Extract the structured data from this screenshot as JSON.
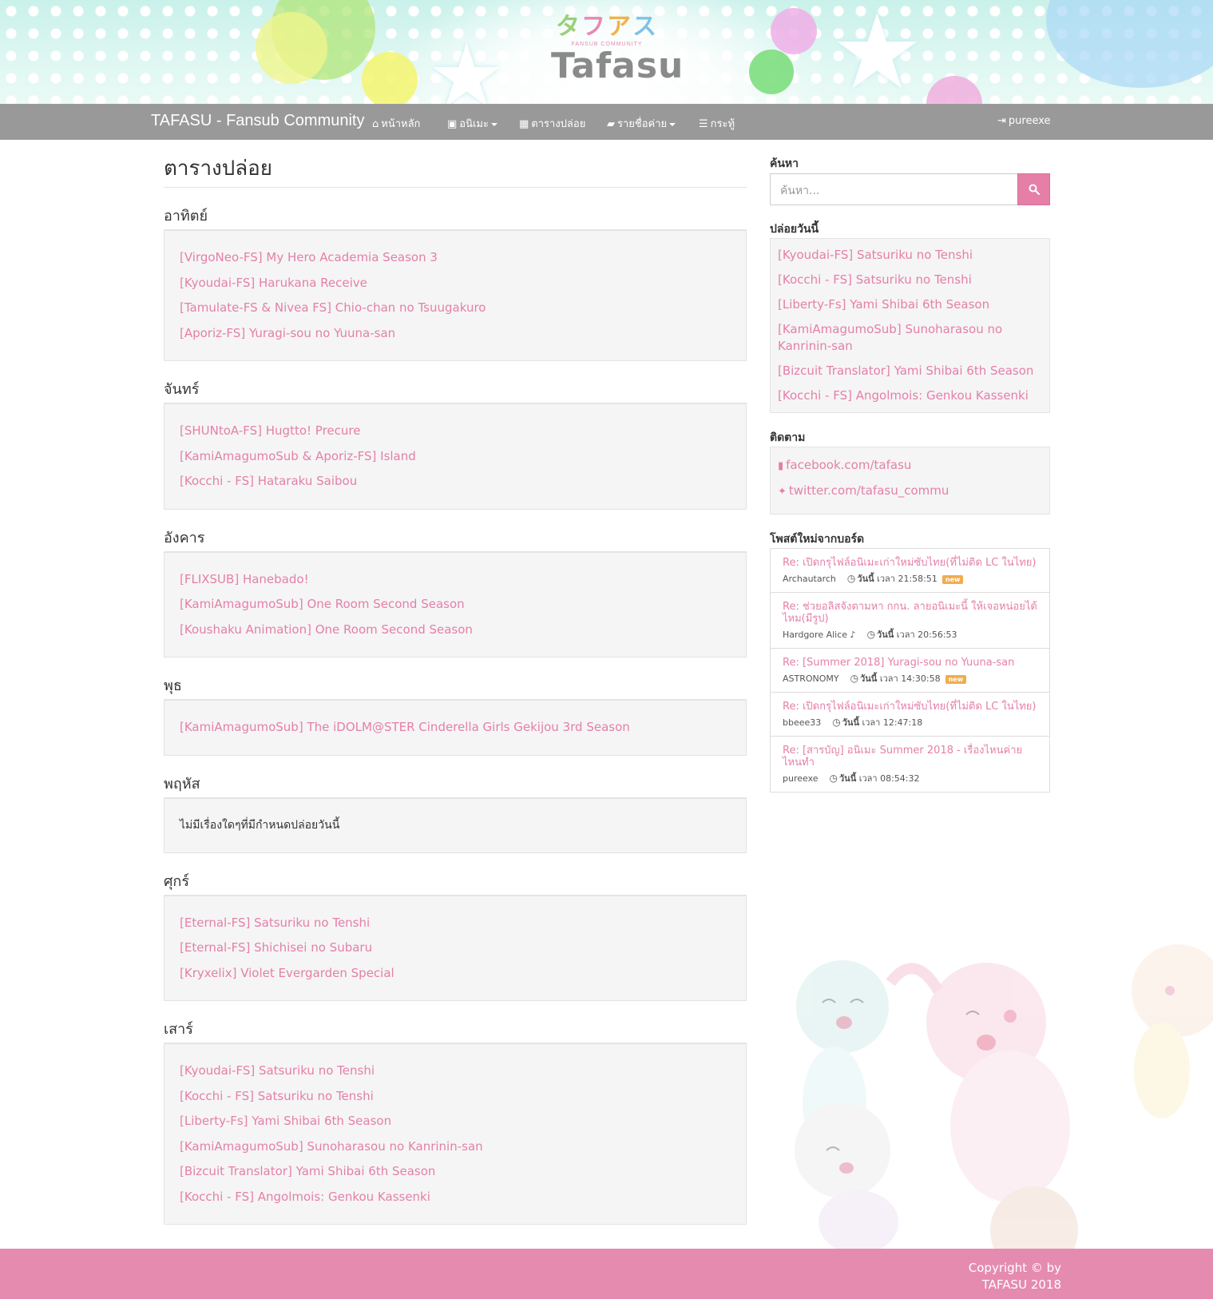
{
  "banner": {
    "logo_jp": [
      "タ",
      "フ",
      "ア",
      "ス"
    ],
    "logo_sub": "FANSUB COMMUNITY",
    "logo_en": "Tafasu"
  },
  "navbar": {
    "brand": "TAFASU - Fansub Community",
    "items": [
      {
        "label": "หน้าหลัก",
        "icon": "home-icon"
      },
      {
        "label": "อนิเมะ",
        "icon": "film-icon"
      },
      {
        "label": "ตารางปล่อย",
        "icon": "calendar-icon"
      },
      {
        "label": "รายชื่อค่าย",
        "icon": "folder-open-icon"
      },
      {
        "label": "กระทู้",
        "icon": "list-icon"
      }
    ],
    "user": "pureexe",
    "user_icon": "login-icon"
  },
  "main": {
    "title": "ตารางปล่อย",
    "days": [
      {
        "name": "อาทิตย์",
        "items": [
          "[VirgoNeo-FS] My Hero Academia Season 3",
          "[Kyoudai-FS] Harukana Receive",
          "[Tamulate-FS & Nivea FS] Chio-chan no Tsuugakuro",
          "[Aporiz-FS] Yuragi-sou no Yuuna-san"
        ]
      },
      {
        "name": "จันทร์",
        "items": [
          "[SHUNtoA-FS] Hugtto! Precure",
          "[KamiAmagumoSub & Aporiz-FS] Island",
          "[Kocchi - FS] Hataraku Saibou"
        ]
      },
      {
        "name": "อังคาร",
        "items": [
          "[FLIXSUB] Hanebado!",
          "[KamiAmagumoSub] One Room Second Season",
          "[Koushaku Animation] One Room Second Season"
        ]
      },
      {
        "name": "พุธ",
        "items": [
          "[KamiAmagumoSub] The iDOLM@STER Cinderella Girls Gekijou 3rd Season"
        ]
      },
      {
        "name": "พฤหัส",
        "items": [],
        "empty_text": "ไม่มีเรื่องใดๆที่มีกำหนดปล่อยวันนี้"
      },
      {
        "name": "ศุกร์",
        "items": [
          "[Eternal-FS] Satsuriku no Tenshi",
          "[Eternal-FS] Shichisei no Subaru",
          "[Kryxelix] Violet Evergarden Special"
        ]
      },
      {
        "name": "เสาร์",
        "items": [
          "[Kyoudai-FS] Satsuriku no Tenshi",
          "[Kocchi - FS] Satsuriku no Tenshi",
          "[Liberty-Fs] Yami Shibai 6th Season",
          "[KamiAmagumoSub] Sunoharasou no Kanrinin-san",
          "[Bizcuit Translator] Yami Shibai 6th Season",
          "[Kocchi - FS] Angolmois: Genkou Kassenki"
        ]
      }
    ]
  },
  "sidebar": {
    "search_heading": "ค้นหา",
    "search_placeholder": "ค้นหา...",
    "today_heading": "ปล่อยวันนี้",
    "today_items": [
      "[Kyoudai-FS] Satsuriku no Tenshi",
      "[Kocchi - FS] Satsuriku no Tenshi",
      "[Liberty-Fs] Yami Shibai 6th Season",
      "[KamiAmagumoSub] Sunoharasou no Kanrinin-san",
      "[Bizcuit Translator] Yami Shibai 6th Season",
      "[Kocchi - FS] Angolmois: Genkou Kassenki"
    ],
    "follow_heading": "ติดตาม",
    "follow_links": [
      {
        "label": "facebook.com/tafasu",
        "icon": "facebook-icon"
      },
      {
        "label": "twitter.com/tafasu_commu",
        "icon": "twitter-icon"
      }
    ],
    "posts_heading": "โพสต์ใหม่จากบอร์ด",
    "posts": [
      {
        "title": "Re: เปิดกรุไฟล์อนิเมะเก่าใหม่ซับไทย(ที่ไม่ติด LC ในไทย)",
        "author": "Archautarch",
        "day": "วันนี้",
        "time_prefix": "เวลา",
        "time": "21:58:51",
        "badge": "new"
      },
      {
        "title": "Re: ช่วยอลิสจังตามหา กกน. ลายอนิเมะนี้ ให้เจอหน่อยได้ไหม(มีรูป)",
        "author": "Hardgore Alice ♪",
        "day": "วันนี้",
        "time_prefix": "เวลา",
        "time": "20:56:53",
        "badge": ""
      },
      {
        "title": "Re: [Summer 2018] Yuragi-sou no Yuuna-san",
        "author": "ASTRONOMY",
        "day": "วันนี้",
        "time_prefix": "เวลา",
        "time": "14:30:58",
        "badge": "new"
      },
      {
        "title": "Re: เปิดกรุไฟล์อนิเมะเก่าใหม่ซับไทย(ที่ไม่ติด LC ในไทย)",
        "author": "bbeee33",
        "day": "วันนี้",
        "time_prefix": "เวลา",
        "time": "12:47:18",
        "badge": ""
      },
      {
        "title": "Re: [สารบัญ] อนิเมะ Summer 2018 - เรื่องไหนค่ายไหนทำ",
        "author": "pureexe",
        "day": "วันนี้",
        "time_prefix": "เวลา",
        "time": "08:54:32",
        "badge": ""
      }
    ]
  },
  "footer": {
    "line1": "Copyright © by",
    "line2": "TAFASU 2018"
  },
  "colors": {
    "accent": "#e57fa8",
    "navbar": "#999999",
    "footer": "#e58bb0",
    "badge": "#f0ad4e"
  }
}
